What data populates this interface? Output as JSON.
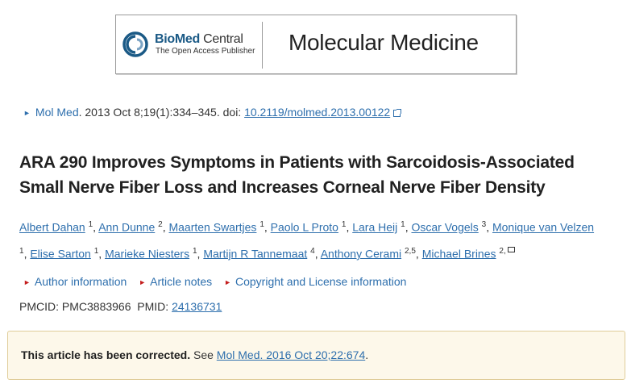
{
  "banner": {
    "publisher_bold": "BioMed",
    "publisher_light": " Central",
    "publisher_tagline": "The Open Access Publisher",
    "journal_name": "Molecular Medicine"
  },
  "citation": {
    "journal_link": "Mol Med",
    "details": ". 2013 Oct 8;19(1):334–345. doi: ",
    "doi": "10.2119/molmed.2013.00122"
  },
  "article": {
    "title": "ARA 290 Improves Symptoms in Patients with Sarcoidosis-Associated Small Nerve Fiber Loss and Increases Corneal Nerve Fiber Density"
  },
  "authors": [
    {
      "name": "Albert Dahan",
      "sup": "1"
    },
    {
      "name": "Ann Dunne",
      "sup": "2"
    },
    {
      "name": "Maarten Swartjes",
      "sup": "1"
    },
    {
      "name": "Paolo L Proto",
      "sup": "1"
    },
    {
      "name": "Lara Heij",
      "sup": "1"
    },
    {
      "name": "Oscar Vogels",
      "sup": "3"
    },
    {
      "name": "Monique van Velzen",
      "sup": "1"
    },
    {
      "name": "Elise Sarton",
      "sup": "1"
    },
    {
      "name": "Marieke Niesters",
      "sup": "1"
    },
    {
      "name": "Martijn R Tannemaat",
      "sup": "4"
    },
    {
      "name": "Anthony Cerami",
      "sup": "2,5"
    },
    {
      "name": "Michael Brines",
      "sup": "2,"
    }
  ],
  "info_links": {
    "author_information": "Author information",
    "article_notes": "Article notes",
    "copyright": "Copyright and License information"
  },
  "ids": {
    "pmcid_label": "PMCID: ",
    "pmcid": "PMC3883966",
    "pmid_label": "PMID: ",
    "pmid": "24136731"
  },
  "correction": {
    "notice": "This article has been corrected.",
    "see": " See ",
    "link": "Mol Med. 2016 Oct 20;22:674",
    "end": "."
  },
  "colors": {
    "link": "#2e6fad",
    "accent_red": "#c41e1e",
    "correction_bg": "#fdf8ea"
  }
}
